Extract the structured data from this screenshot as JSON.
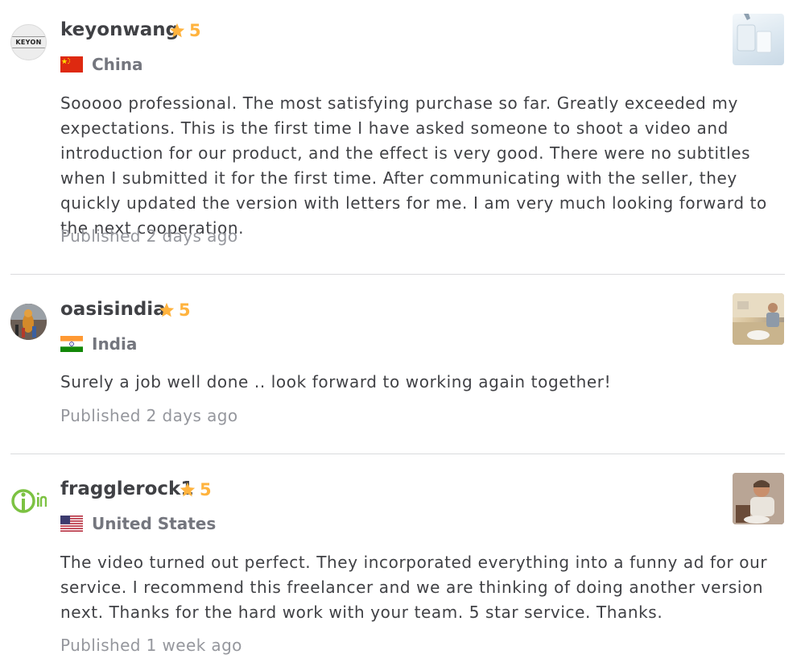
{
  "reviews": [
    {
      "username": "keyonwang",
      "rating": "5",
      "country": "China",
      "avatar_text": "KEYON",
      "text": "Sooooo professional. The most satisfying purchase so far. Greatly exceeded my expectations. This is the first time I have asked someone to shoot a video and introduction for our product, and the effect is very good. There were no subtitles when I submitted it for the first time. After communicating with the seller, they quickly updated the version with letters for me. I am very much looking forward to the next cooperation.",
      "published": "Published 2 days ago"
    },
    {
      "username": "oasisindia",
      "rating": "5",
      "country": "India",
      "text": "Surely a job well done .. look forward to working again together!",
      "published": "Published 2 days ago"
    },
    {
      "username": "fragglerock1",
      "rating": "5",
      "country": "United States",
      "text": "The video turned out perfect. They incorporated everything into a funny ad for our service. I recommend this freelancer and we are thinking of doing another version next. Thanks for the hard work with your team. 5 star service. Thanks.",
      "published": "Published 1 week ago"
    }
  ],
  "colors": {
    "star": "#ffb33e",
    "text": "#404145",
    "muted": "#95979d",
    "country": "#74767e",
    "divider": "#dadbdd"
  },
  "icons": {
    "star": "star-icon",
    "flag_china": "china-flag-icon",
    "flag_india": "india-flag-icon",
    "flag_us": "us-flag-icon"
  }
}
